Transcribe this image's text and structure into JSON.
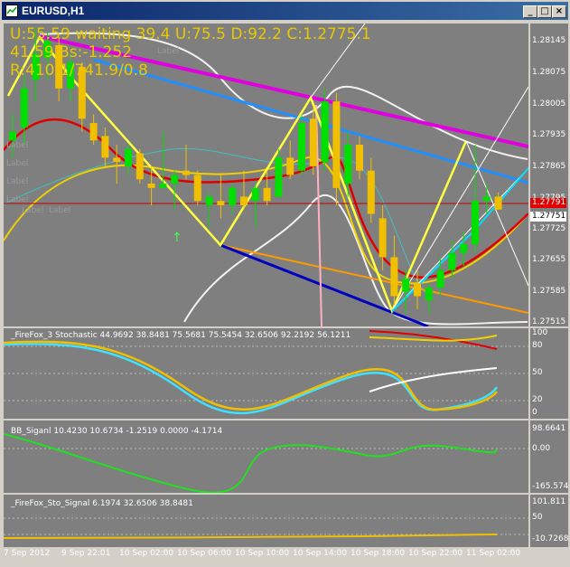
{
  "window": {
    "title": "EURUSD,H1"
  },
  "hud": {
    "line1": "U:55.59  waiting  39.4 U:75.5 D:92.2 C:1.2775.1",
    "line2": "41.59 Bs:-1.252",
    "line3": "R:410.1/741.9/0.8"
  },
  "main_axis": {
    "ticks": [
      "1.28145",
      "1.28075",
      "1.28005",
      "1.27935",
      "1.27865",
      "1.27795",
      "1.27725",
      "1.27655",
      "1.27585",
      "1.27515"
    ],
    "price_tag_red": "1.27791",
    "price_tag_white": "1.27751"
  },
  "indicators": [
    {
      "label": "_FireFox_3 Stochastic 44.9692 38.8481 75.5681 75.5454 32.6506 92.2192 56.1211",
      "ticks": [
        "100",
        "80",
        "50",
        "20",
        "0"
      ]
    },
    {
      "label": "BB_Siganl 10.4230 10.6734 -1.2519 0.0000 -4.1714",
      "ticks": [
        "98.6641",
        "0.00",
        "-165.574"
      ]
    },
    {
      "label": "_FireFox_Sto_Signal 6.1974 32.6506 38.8481",
      "ticks": [
        "101.811",
        "50",
        "-10.7268"
      ]
    }
  ],
  "time_axis": [
    "7 Sep 2012",
    "9 Sep 22:01",
    "10 Sep 02:00",
    "10 Sep 06:00",
    "10 Sep 10:00",
    "10 Sep 14:00",
    "10 Sep 18:00",
    "10 Sep 22:00",
    "11 Sep 02:00"
  ],
  "ghost_labels": [
    "Label",
    "Label",
    "Label",
    "Label",
    "Label",
    "Label",
    "Label"
  ],
  "colors": {
    "background": "#7f7f7f",
    "bull": "#00e000",
    "bear": "#f0c000",
    "hud": "#e8c800"
  },
  "chart_data": {
    "type": "candlestick",
    "title": "EURUSD,H1",
    "ylim": [
      1.2748,
      1.2818
    ],
    "x": [
      "7 Sep 2012",
      "9 Sep 22:01",
      "10 Sep 02:00",
      "10 Sep 06:00",
      "10 Sep 10:00",
      "10 Sep 14:00",
      "10 Sep 18:00",
      "10 Sep 22:00",
      "11 Sep 02:00"
    ],
    "candles": [
      [
        1.2791,
        1.2797,
        1.2787,
        1.2793
      ],
      [
        1.2794,
        1.2806,
        1.279,
        1.2803
      ],
      [
        1.2805,
        1.2817,
        1.28,
        1.2811
      ],
      [
        1.281,
        1.2816,
        1.2805,
        1.2814
      ],
      [
        1.2813,
        1.2815,
        1.28,
        1.2803
      ],
      [
        1.2803,
        1.2811,
        1.28,
        1.2809
      ],
      [
        1.2808,
        1.2809,
        1.2793,
        1.2796
      ],
      [
        1.2795,
        1.2797,
        1.279,
        1.2791
      ],
      [
        1.2792,
        1.2794,
        1.2785,
        1.2787
      ],
      [
        1.2787,
        1.279,
        1.2781,
        1.2786
      ],
      [
        1.2785,
        1.279,
        1.2783,
        1.2789
      ],
      [
        1.2788,
        1.2789,
        1.2781,
        1.2782
      ],
      [
        1.2781,
        1.2785,
        1.2776,
        1.278
      ],
      [
        1.278,
        1.2793,
        1.278,
        1.2781
      ],
      [
        1.2781,
        1.2784,
        1.2775,
        1.2783
      ],
      [
        1.2784,
        1.279,
        1.2782,
        1.2783
      ],
      [
        1.2783,
        1.2784,
        1.2776,
        1.2777
      ],
      [
        1.2776,
        1.2779,
        1.2771,
        1.2778
      ],
      [
        1.2777,
        1.2783,
        1.2773,
        1.2776
      ],
      [
        1.2776,
        1.2781,
        1.2774,
        1.278
      ],
      [
        1.2778,
        1.2784,
        1.2775,
        1.2776
      ],
      [
        1.2777,
        1.2781,
        1.2771,
        1.278
      ],
      [
        1.278,
        1.2784,
        1.2776,
        1.2777
      ],
      [
        1.2778,
        1.2789,
        1.2778,
        1.2787
      ],
      [
        1.2787,
        1.2791,
        1.2782,
        1.2783
      ],
      [
        1.2784,
        1.2797,
        1.2783,
        1.2795
      ],
      [
        1.2796,
        1.2799,
        1.2783,
        1.2785
      ],
      [
        1.2786,
        1.2803,
        1.2784,
        1.28
      ],
      [
        1.28,
        1.2802,
        1.2776,
        1.278
      ],
      [
        1.2781,
        1.2793,
        1.2778,
        1.279
      ],
      [
        1.279,
        1.2792,
        1.2782,
        1.2784
      ],
      [
        1.2784,
        1.2787,
        1.2772,
        1.2774
      ],
      [
        1.2773,
        1.2776,
        1.2761,
        1.2764
      ],
      [
        1.2764,
        1.2769,
        1.2753,
        1.2755
      ],
      [
        1.2756,
        1.2761,
        1.2751,
        1.2759
      ],
      [
        1.2758,
        1.2761,
        1.2752,
        1.2755
      ],
      [
        1.2754,
        1.2758,
        1.2751,
        1.2757
      ],
      [
        1.2757,
        1.2764,
        1.2755,
        1.2761
      ],
      [
        1.2761,
        1.2768,
        1.2759,
        1.2765
      ],
      [
        1.2765,
        1.277,
        1.2762,
        1.2767
      ],
      [
        1.2767,
        1.279,
        1.2765,
        1.2777
      ],
      [
        1.2777,
        1.2781,
        1.2774,
        1.2778
      ],
      [
        1.2778,
        1.2779,
        1.2775,
        1.2775
      ]
    ]
  }
}
